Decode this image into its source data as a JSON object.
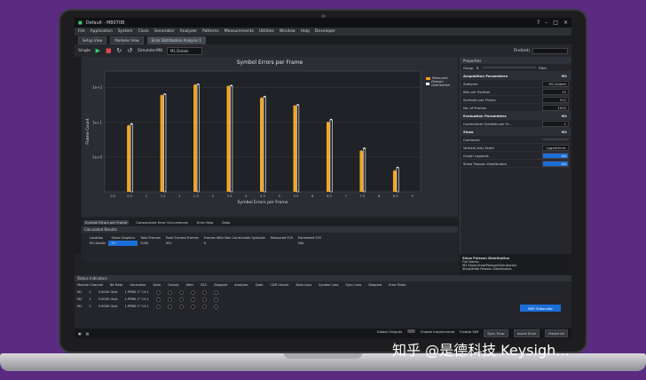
{
  "window": {
    "title": "Default - M8070B"
  },
  "menu": [
    "File",
    "Application",
    "System",
    "Clock",
    "Generator",
    "Analyzer",
    "Patterns",
    "Measurements",
    "Utilities",
    "Window",
    "Help",
    "Developer"
  ],
  "tabs": [
    "Setup View",
    "Modules View",
    "Error Distribution Analysis 1"
  ],
  "toolbar": {
    "single_label": "Single",
    "location_label": "Simulate:M8",
    "location_value": "M1.DataIn",
    "find_label": "Find(ed)"
  },
  "chart": {
    "title": "Symbol Errors per Frame"
  },
  "chart_data": {
    "type": "bar",
    "title": "Symbol Errors per Frame",
    "xlabel": "Symbol Errors per Frame",
    "ylabel": "Frame Count",
    "yscale": "log",
    "ytick_labels": [
      "1e+2",
      "1e+1",
      "1e+0"
    ],
    "categories": [
      "0.0",
      "0.5",
      "1",
      "1.5",
      "2",
      "2.5",
      "3",
      "3.5",
      "4",
      "4.5",
      "5",
      "5.5",
      "6",
      "6.5",
      "7",
      "7.5",
      "8",
      "8.5",
      "9"
    ],
    "legend": [
      {
        "name": "Measured",
        "color": "#f2a623"
      },
      {
        "name": "Poisson Distribution",
        "color": "#ffffff"
      }
    ],
    "series": [
      {
        "name": "Measured",
        "values": [
          null,
          8,
          null,
          60,
          null,
          120,
          null,
          110,
          null,
          50,
          null,
          30,
          null,
          10,
          null,
          1.5,
          null,
          0.4,
          null
        ]
      },
      {
        "name": "Poisson Distribution",
        "values": [
          null,
          9,
          null,
          65,
          null,
          125,
          null,
          115,
          null,
          55,
          null,
          32,
          null,
          12,
          null,
          1.8,
          null,
          0.5,
          null
        ]
      }
    ]
  },
  "bottom_tabs": [
    "Symbol Errors per Frame",
    "Consecutive Error Occurrences",
    "Error Map",
    "Data"
  ],
  "results": {
    "header": "Calculated Results",
    "columns": [
      "Location",
      "Show Graphics",
      "Total Frames",
      "Total Errored Frames",
      "Frames With Non Correctable Symbols",
      "Measured FLR",
      "Estimated FLR"
    ],
    "row": [
      "M1.DataIn",
      "On",
      "2000",
      "901",
      "0",
      "",
      "N/A"
    ]
  },
  "properties": {
    "header": "Properties",
    "group_label": "Group",
    "filter_label": "Filter",
    "rows": [
      {
        "label": "Acquisition Parameters",
        "value": "M1",
        "section": true
      },
      {
        "label": "Analyzer",
        "value": "M1.DataIn"
      },
      {
        "label": "Bits per Symbol",
        "value": "10"
      },
      {
        "label": "Symbols per Frame",
        "value": "512"
      },
      {
        "label": "No. of Frames",
        "value": "1000"
      },
      {
        "label": "Evaluation Parameters",
        "value": "M1",
        "section": true
      },
      {
        "label": "Correctable Symbols per Fr...",
        "value": "1"
      },
      {
        "label": "Show",
        "value": "M1",
        "section": true
      },
      {
        "label": "Comment",
        "value": ""
      },
      {
        "label": "Vertical Axis Scale",
        "value": "Logarithmic"
      },
      {
        "label": "Graph Legends",
        "value": "On",
        "blue": true
      },
      {
        "label": "Show Poisson Distribution",
        "value": "On",
        "blue": true
      }
    ],
    "desc_title": "Show Poisson Distribution",
    "desc_lines": [
      "Full Name:",
      "M1.Show.ShowPoissonDistribution",
      "Show/Hide Poisson Distribution"
    ]
  },
  "status": {
    "header": "Status Indicators",
    "columns": [
      "Module Channel",
      "Bit Rate",
      "Generator",
      "Data",
      "Output",
      "Jitter",
      "SSC",
      "Stopped",
      "Analyzer",
      "Data",
      "CDR Unlock",
      "Data Loss",
      "Symbol Loss",
      "Sync Loss",
      "Stopped",
      "Error Ratio"
    ],
    "rows": [
      {
        "ch": "M1",
        "n": "1",
        "rate": "5.0000 Gb/s",
        "data": "1.PRBS 2^15-1"
      },
      {
        "ch": "M2",
        "n": "1",
        "rate": "5.0000 Gb/s",
        "data": "1.PRBS 2^15-1"
      },
      {
        "ch": "M1",
        "n": "2",
        "rate": "5.0000 Gb/s",
        "data": "1.PRBS 2^15-1"
      }
    ],
    "blue_button": "BER Subscribe"
  },
  "footer": {
    "global_outputs": "Global Outputs",
    "enable_impairments": "Enable Impairments",
    "enable_sim": "Enable SIM",
    "sync_error": "Sync Error",
    "insert_error": "Insert Error",
    "preset_all": "Preset All"
  },
  "watermark": "知乎 @是德科技 Keysigh..."
}
